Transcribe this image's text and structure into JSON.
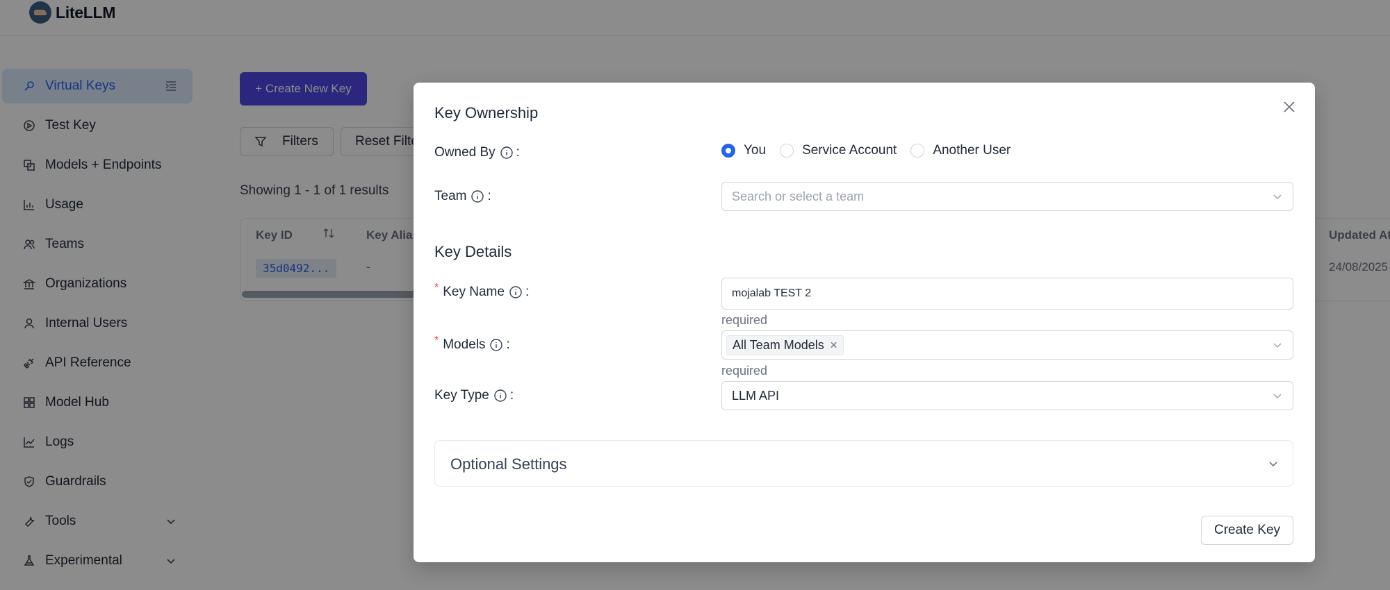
{
  "app": {
    "name": "LiteLLM"
  },
  "sidebar": {
    "items": [
      {
        "label": "Virtual Keys",
        "icon": "key-icon",
        "active": true
      },
      {
        "label": "Test Key",
        "icon": "play-circle-icon"
      },
      {
        "label": "Models + Endpoints",
        "icon": "block-icon"
      },
      {
        "label": "Usage",
        "icon": "bar-chart-icon"
      },
      {
        "label": "Teams",
        "icon": "team-icon"
      },
      {
        "label": "Organizations",
        "icon": "bank-icon"
      },
      {
        "label": "Internal Users",
        "icon": "user-icon"
      },
      {
        "label": "API Reference",
        "icon": "api-icon"
      },
      {
        "label": "Model Hub",
        "icon": "apps-icon"
      },
      {
        "label": "Logs",
        "icon": "line-chart-icon"
      },
      {
        "label": "Guardrails",
        "icon": "safety-icon"
      },
      {
        "label": "Tools",
        "icon": "tool-icon"
      },
      {
        "label": "Experimental",
        "icon": "experiment-icon"
      }
    ]
  },
  "main": {
    "create_button": "+ Create New Key",
    "filters_button": "Filters",
    "reset_button": "Reset Filters",
    "showing": "Showing 1 - 1 of 1 results",
    "table": {
      "headers": [
        "Key ID",
        "Key Alias",
        "Updated At"
      ],
      "rows": [
        {
          "key_id": "35d0492...",
          "key_alias": "-",
          "updated_at": "24/08/2025"
        }
      ]
    }
  },
  "modal": {
    "ownership_title": "Key Ownership",
    "owned_by_label": "Owned By",
    "owned_by_options": [
      "You",
      "Service Account",
      "Another User"
    ],
    "owned_by_selected": "You",
    "team_label": "Team",
    "team_placeholder": "Search or select a team",
    "details_title": "Key Details",
    "key_name_label": "Key Name",
    "key_name_value": "mojalab TEST 2",
    "key_name_helper": "required",
    "models_label": "Models",
    "models_tag": "All Team Models",
    "models_helper": "required",
    "key_type_label": "Key Type",
    "key_type_value": "LLM API",
    "optional_settings": "Optional Settings",
    "submit": "Create Key",
    "colon": ":"
  },
  "colors": {
    "accent": "#4f46e5",
    "link": "#2563eb",
    "required": "#ef4444"
  }
}
